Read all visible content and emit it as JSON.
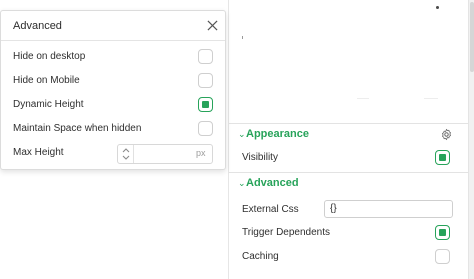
{
  "popup": {
    "title": "Advanced",
    "rows": [
      {
        "label": "Hide on desktop",
        "checked": false
      },
      {
        "label": "Hide on Mobile",
        "checked": false
      },
      {
        "label": "Dynamic Height",
        "checked": true
      },
      {
        "label": "Maintain Space when hidden",
        "checked": false
      }
    ],
    "max_height": {
      "label": "Max Height",
      "value": "",
      "unit": "px"
    }
  },
  "panel": {
    "appearance": {
      "title": "Appearance",
      "visibility_label": "Visibility",
      "visibility_checked": true
    },
    "advanced": {
      "title": "Advanced",
      "external_css_label": "External Css",
      "external_css_value": "{}",
      "trigger_label": "Trigger Dependents",
      "trigger_checked": true,
      "caching_label": "Caching",
      "caching_checked": false
    }
  },
  "colors": {
    "accent": "#27a35a",
    "border": "#cfcfcf"
  },
  "icons": [
    "close-icon",
    "gear-icon",
    "chevron-down-icon",
    "chevron-up-icon"
  ]
}
